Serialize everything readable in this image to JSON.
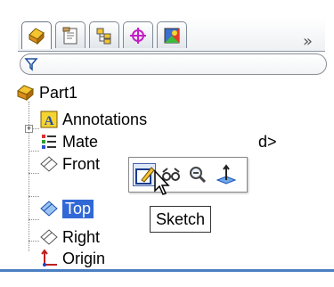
{
  "tabs": [
    {
      "icon": "featuremanager-icon",
      "active": true
    },
    {
      "icon": "propertymanager-icon",
      "active": false
    },
    {
      "icon": "configurationmanager-icon",
      "active": false
    },
    {
      "icon": "dimxpertmanager-icon",
      "active": false
    },
    {
      "icon": "displaymanager-icon",
      "active": false
    }
  ],
  "overflow_label": "»",
  "filter": {
    "icon": "filter-icon",
    "value": ""
  },
  "tree": {
    "root": "Part1",
    "annotations": "Annotations",
    "material_visible": "Mate",
    "material_tail": "d>",
    "front": "Front",
    "top": "Top",
    "right": "Right",
    "origin": "Origin"
  },
  "popup": {
    "buttons": [
      "sketch-icon",
      "hide-show-icon",
      "zoom-to-selection-icon",
      "normal-to-icon"
    ]
  },
  "tooltip": "Sketch",
  "colors": {
    "selection": "#3168d5",
    "accent": "#4a7fc1"
  }
}
